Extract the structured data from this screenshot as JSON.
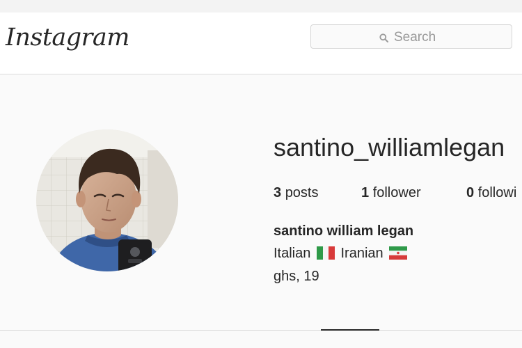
{
  "header": {
    "logo_text": "Instagram",
    "search": {
      "placeholder": "Search",
      "icon": "magnifier-icon"
    }
  },
  "profile": {
    "username": "santino_williamlegan",
    "stats": {
      "posts": {
        "count": "3",
        "label": "posts"
      },
      "followers": {
        "count": "1",
        "label": "follower"
      },
      "following": {
        "count": "0",
        "label": "followi"
      }
    },
    "full_name": "santino william legan",
    "bio": {
      "line1": {
        "word1": "Italian",
        "flag1": "italy-flag-icon",
        "word2": "Iranian",
        "flag2": "iran-flag-icon"
      },
      "line2": "ghs, 19"
    },
    "avatar": {
      "icon": "profile-photo"
    }
  },
  "colors": {
    "page_bg": "#fafafa",
    "header_bg": "#ffffff",
    "text": "#262626",
    "muted": "#999999",
    "border": "#dbdbdb"
  }
}
